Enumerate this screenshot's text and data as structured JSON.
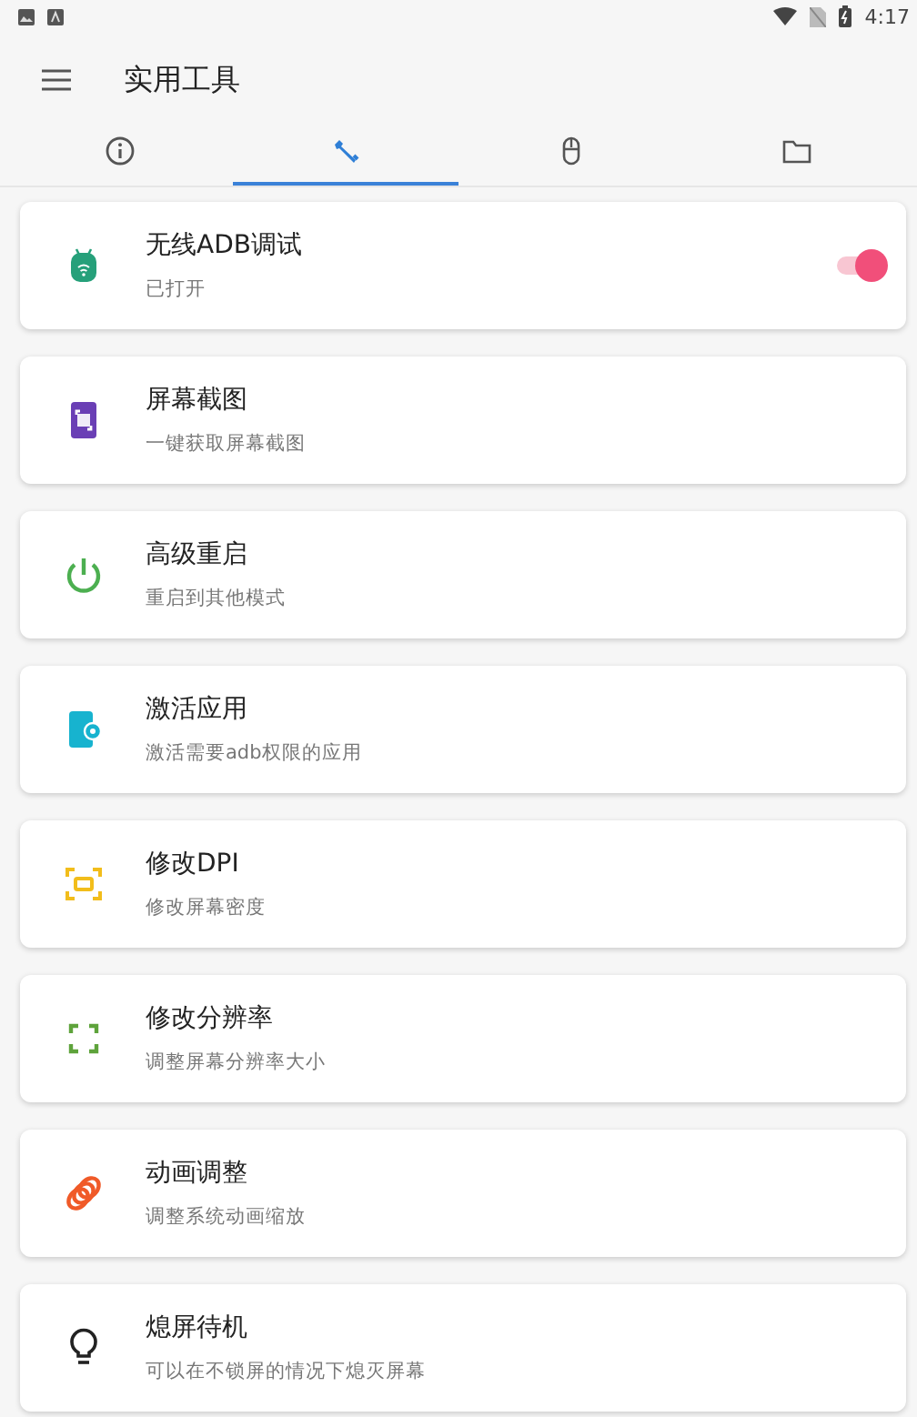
{
  "status_bar": {
    "time": "4:17"
  },
  "toolbar": {
    "title": "实用工具"
  },
  "tabs": [
    {
      "selected": false
    },
    {
      "selected": true
    },
    {
      "selected": false
    },
    {
      "selected": false
    }
  ],
  "items": [
    {
      "kind": "switch",
      "title": "无线ADB调试",
      "subtitle": "已打开",
      "on": true
    },
    {
      "kind": "plain",
      "title": "屏幕截图",
      "subtitle": "一键获取屏幕截图"
    },
    {
      "kind": "plain",
      "title": "高级重启",
      "subtitle": "重启到其他模式"
    },
    {
      "kind": "plain",
      "title": "激活应用",
      "subtitle": "激活需要adb权限的应用"
    },
    {
      "kind": "plain",
      "title": "修改DPI",
      "subtitle": "修改屏幕密度"
    },
    {
      "kind": "plain",
      "title": "修改分辨率",
      "subtitle": "调整屏幕分辨率大小"
    },
    {
      "kind": "plain",
      "title": "动画调整",
      "subtitle": "调整系统动画缩放"
    },
    {
      "kind": "plain",
      "title": "熄屏待机",
      "subtitle": "可以在不锁屏的情况下熄灭屏幕"
    }
  ]
}
